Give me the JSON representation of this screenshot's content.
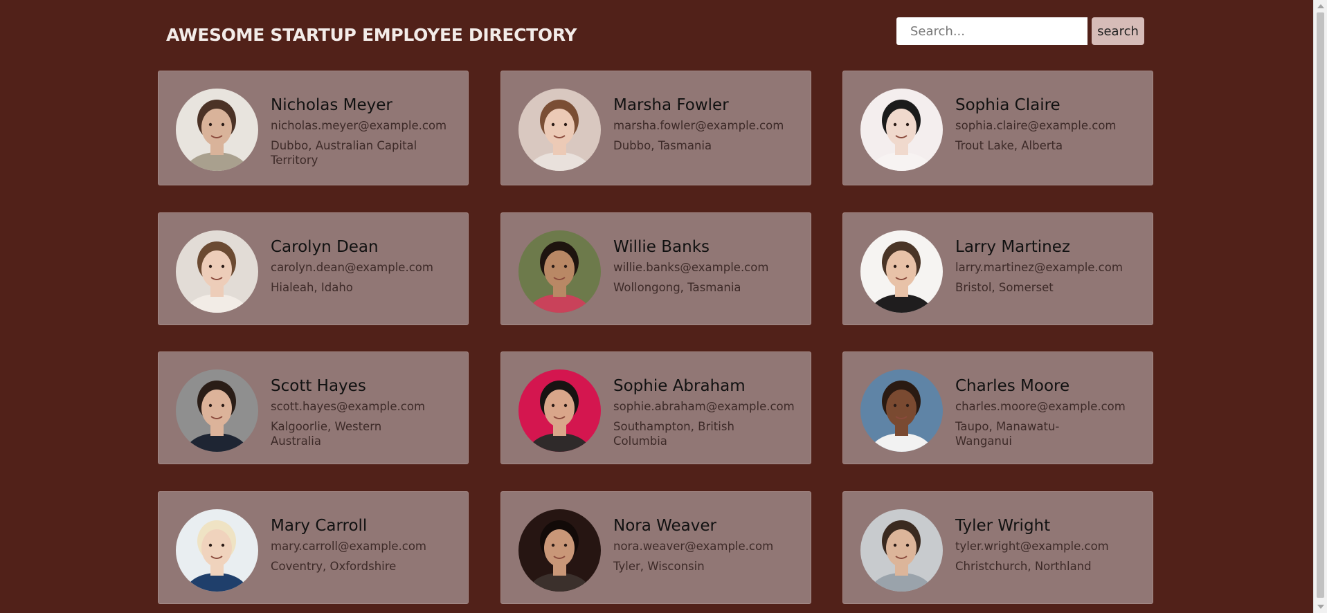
{
  "header": {
    "title": "AWESOME STARTUP EMPLOYEE DIRECTORY"
  },
  "search": {
    "placeholder": "Search...",
    "value": "",
    "button_label": "search"
  },
  "employees": [
    {
      "name": "Nicholas Meyer",
      "email": "nicholas.meyer@example.com",
      "location": "Dubbo, Australian Capital Territory",
      "avatar_bg": "#e8e4de",
      "skin": "#d9b39a",
      "hair": "#4b3226",
      "shirt": "#a9a08e"
    },
    {
      "name": "Marsha Fowler",
      "email": "marsha.fowler@example.com",
      "location": "Dubbo, Tasmania",
      "avatar_bg": "#d9c8c0",
      "skin": "#eccab6",
      "hair": "#7a4e34",
      "shirt": "#e9e1dc"
    },
    {
      "name": "Sophia Claire",
      "email": "sophia.claire@example.com",
      "location": "Trout Lake, Alberta",
      "avatar_bg": "#f4eeee",
      "skin": "#f0d9cd",
      "hair": "#1b1b1b",
      "shirt": "#f7f3f2"
    },
    {
      "name": "Carolyn Dean",
      "email": "carolyn.dean@example.com",
      "location": "Hialeah, Idaho",
      "avatar_bg": "#e2dcd6",
      "skin": "#edcdb9",
      "hair": "#6b4a32",
      "shirt": "#f2ece6"
    },
    {
      "name": "Willie Banks",
      "email": "willie.banks@example.com",
      "location": "Wollongong, Tasmania",
      "avatar_bg": "#6d7a4b",
      "skin": "#b98865",
      "hair": "#1e140f",
      "shirt": "#c9425a"
    },
    {
      "name": "Larry Martinez",
      "email": "larry.martinez@example.com",
      "location": "Bristol, Somerset",
      "avatar_bg": "#f6f4f2",
      "skin": "#e8c2a8",
      "hair": "#4a3527",
      "shirt": "#1f1d1e"
    },
    {
      "name": "Scott Hayes",
      "email": "scott.hayes@example.com",
      "location": "Kalgoorlie, Western Australia",
      "avatar_bg": "#8f8f8f",
      "skin": "#dcb39a",
      "hair": "#2a1d17",
      "shirt": "#1e2533"
    },
    {
      "name": "Sophie Abraham",
      "email": "sophie.abraham@example.com",
      "location": "Southampton, British Columbia",
      "avatar_bg": "#d4164f",
      "skin": "#d9a68a",
      "hair": "#171312",
      "shirt": "#2f2a2a"
    },
    {
      "name": "Charles Moore",
      "email": "charles.moore@example.com",
      "location": "Taupo, Manawatu-Wanganui",
      "avatar_bg": "#5f84a6",
      "skin": "#7a4a31",
      "hair": "#2a1a12",
      "shirt": "#f2f2f2"
    },
    {
      "name": "Mary Carroll",
      "email": "mary.carroll@example.com",
      "location": "Coventry, Oxfordshire",
      "avatar_bg": "#e9eef1",
      "skin": "#f0d3bd",
      "hair": "#efe3c4",
      "shirt": "#1f3f6b"
    },
    {
      "name": "Nora Weaver",
      "email": "nora.weaver@example.com",
      "location": "Tyler, Wisconsin",
      "avatar_bg": "#261512",
      "skin": "#c99778",
      "hair": "#120a08",
      "shirt": "#3b302c"
    },
    {
      "name": "Tyler Wright",
      "email": "tyler.wright@example.com",
      "location": "Christchurch, Northland",
      "avatar_bg": "#c8cbce",
      "skin": "#dcb59a",
      "hair": "#3a2a20",
      "shirt": "#9aa3ab"
    }
  ]
}
